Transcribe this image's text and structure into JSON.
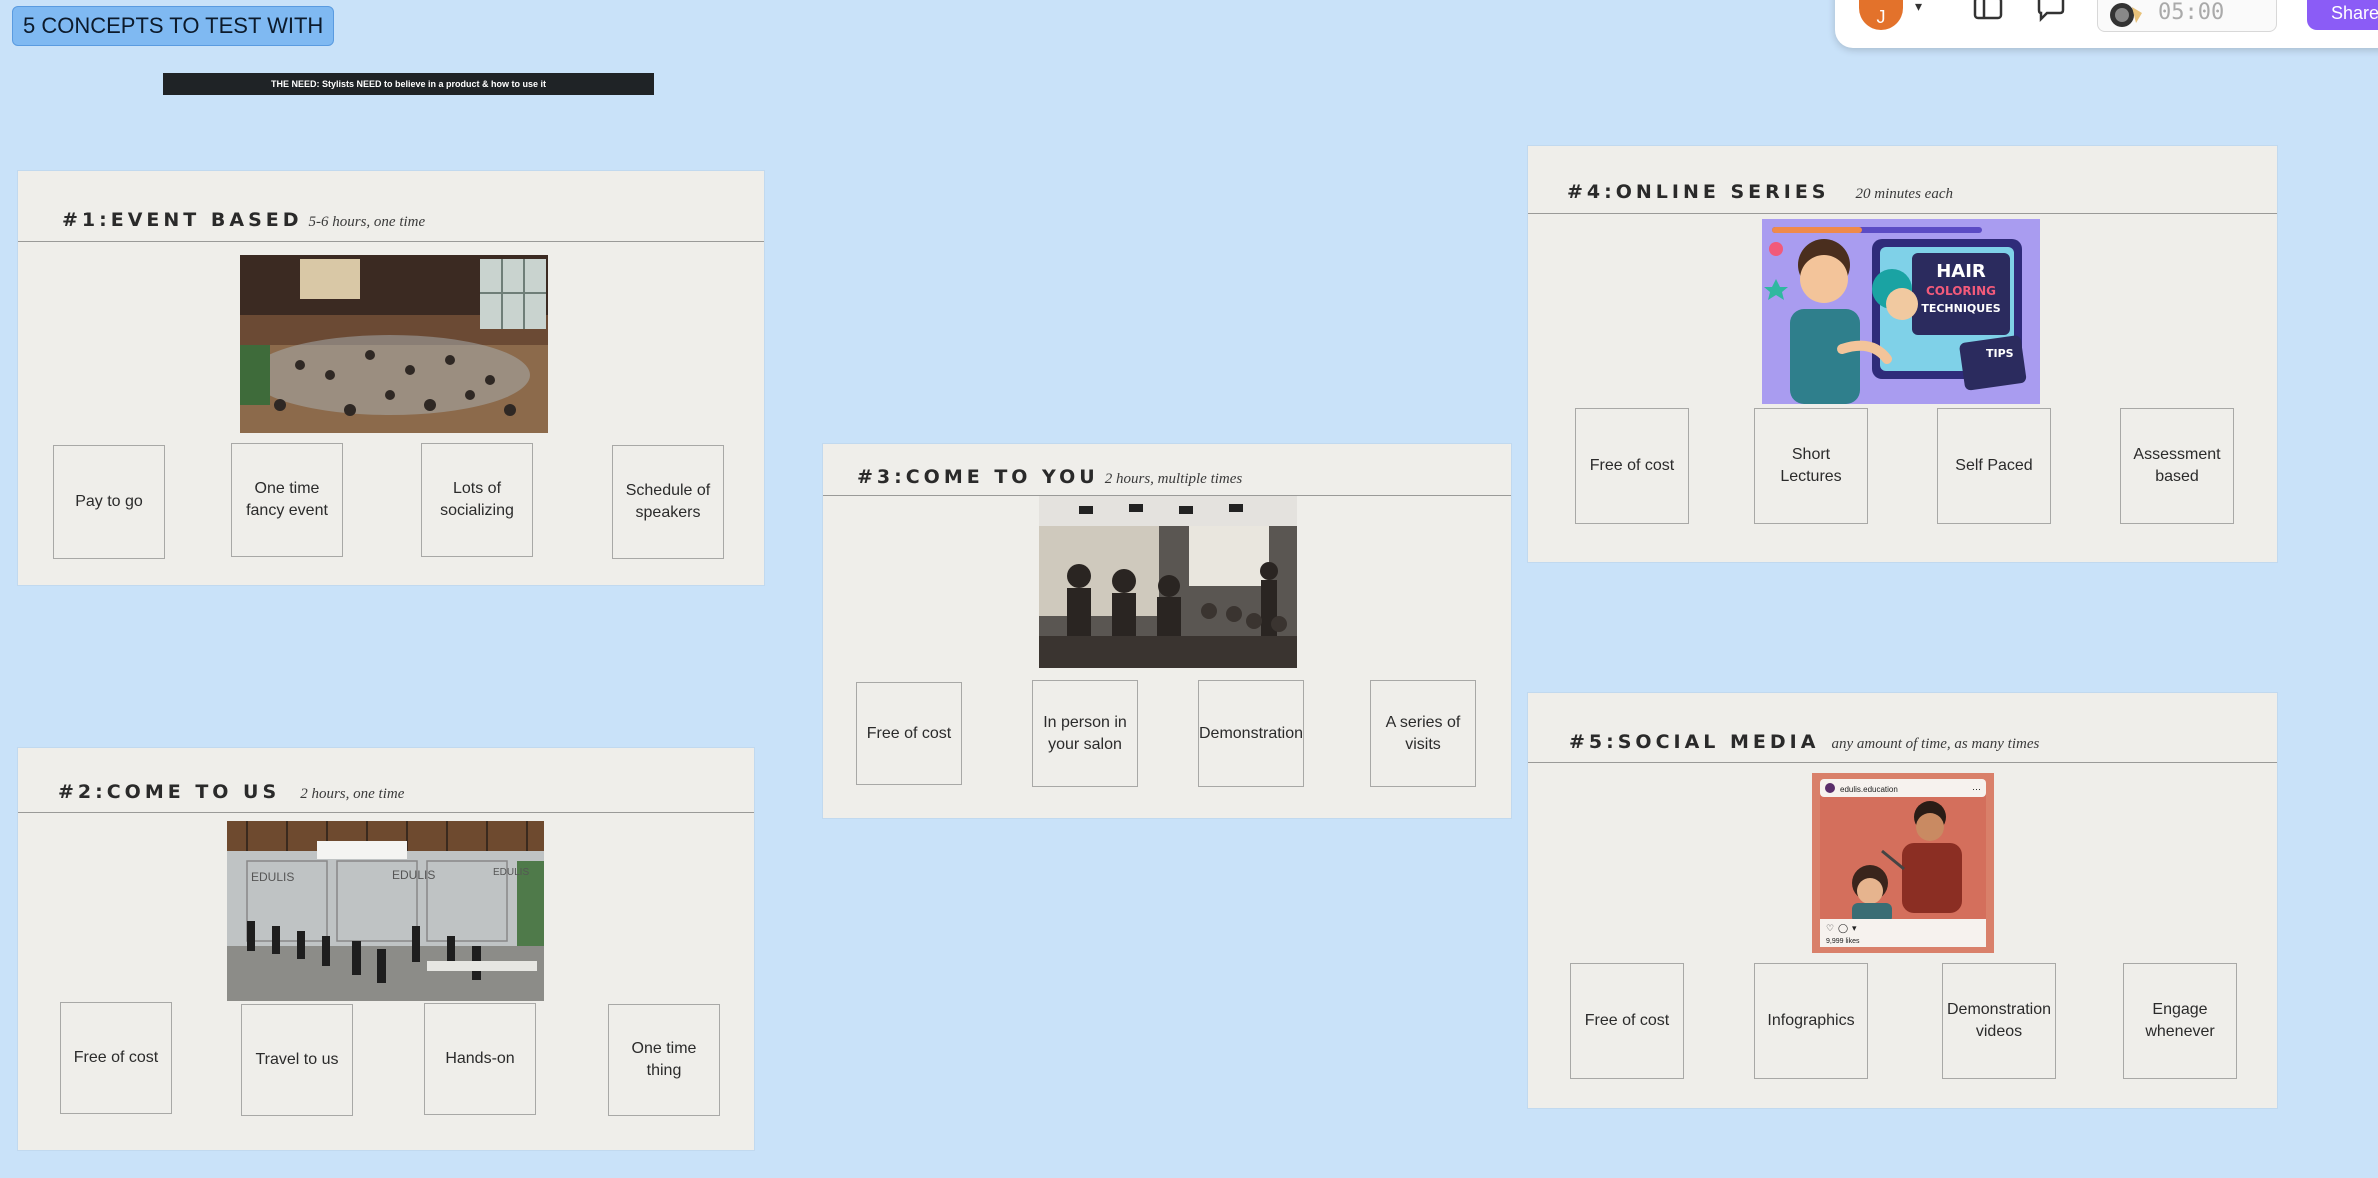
{
  "board": {
    "section_label": "5 CONCEPTS TO TEST WITH",
    "need_text": "THE NEED: Stylists NEED to believe in a product & how to use it"
  },
  "toolbar": {
    "avatar_initial": "J",
    "timer": "05:00",
    "share_label": "Share",
    "colors": {
      "avatar": "#e3722b",
      "share": "#8b5cf6"
    }
  },
  "concepts": [
    {
      "title": "#1:EVENT BASED",
      "subtitle": "5-6 hours, one time",
      "tiles": [
        "Pay to go",
        "One time fancy event",
        "Lots of socializing",
        "Schedule of speakers"
      ]
    },
    {
      "title": "#2:COME TO US",
      "subtitle": "2 hours, one time",
      "tiles": [
        "Free of cost",
        "Travel to us",
        "Hands-on",
        "One time thing"
      ]
    },
    {
      "title": "#3:COME TO YOU",
      "subtitle": "2 hours, multiple times",
      "tiles": [
        "Free of cost",
        "In person in your salon",
        "Demonstration",
        "A series of visits"
      ]
    },
    {
      "title": "#4:ONLINE SERIES",
      "subtitle": "20 minutes each",
      "tiles": [
        "Free of cost",
        "Short Lectures",
        "Self Paced",
        "Assessment based"
      ]
    },
    {
      "title": "#5:SOCIAL MEDIA",
      "subtitle": "any amount of time, as many times",
      "tiles": [
        "Free of cost",
        "Infographics",
        "Demonstration videos",
        "Engage whenever"
      ]
    }
  ],
  "image_text": {
    "hair_line1": "HAIR",
    "hair_line2": "COLORING",
    "hair_line3": "TECHNIQUES",
    "tips": "TIPS",
    "edulis_brand": "EDULIS",
    "insta_handle": "edulis.education",
    "insta_likes": "9,999 likes"
  }
}
